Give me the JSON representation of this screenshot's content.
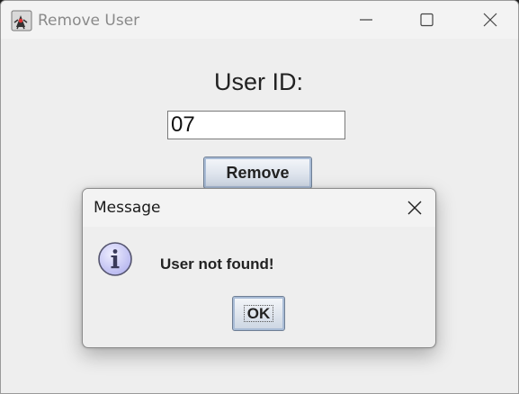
{
  "window": {
    "title": "Remove User",
    "icon": "java-duke-icon",
    "controls": [
      "minimize-icon",
      "maximize-icon",
      "close-icon"
    ]
  },
  "form": {
    "label": "User ID:",
    "user_id_value": "07",
    "remove_label": "Remove"
  },
  "dialog": {
    "title": "Message",
    "icon": "information-icon",
    "message": "User not found!",
    "ok_label": "OK",
    "close_icon": "close-icon"
  },
  "colors": {
    "window_bg": "#eeeeee",
    "button_gradient_top": "#f5f7fa",
    "button_gradient_bottom": "#cbd5e2",
    "info_icon_fill": "#b9b9f0"
  }
}
